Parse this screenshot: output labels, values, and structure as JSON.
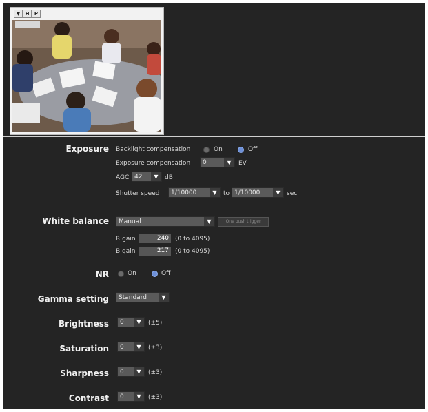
{
  "preview": {
    "buttons": [
      "▼",
      "H",
      "P"
    ],
    "overlay_icons": [
      "camera-control-icon",
      "zoom-icon",
      "focus-icon",
      "preset-icon"
    ]
  },
  "exposure": {
    "label": "Exposure",
    "backlight_label": "Backlight compensation",
    "on_label": "On",
    "off_label": "Off",
    "backlight_selected": "Off",
    "exp_comp_label": "Exposure compensation",
    "exp_comp_value": "0",
    "ev_unit": "EV",
    "agc_label": "AGC",
    "agc_value": "42",
    "db_unit": "dB",
    "shutter_label": "Shutter speed",
    "shutter_from": "1/10000",
    "to_label": "to",
    "shutter_to": "1/10000",
    "sec_unit": "sec."
  },
  "white_balance": {
    "label": "White balance",
    "mode": "Manual",
    "trigger_label": "One push trigger",
    "r_gain_label": "R gain",
    "r_gain": "240",
    "b_gain_label": "B gain",
    "b_gain": "217",
    "range": "(0 to 4095)"
  },
  "nr": {
    "label": "NR",
    "on_label": "On",
    "off_label": "Off",
    "selected": "Off"
  },
  "gamma": {
    "label": "Gamma setting",
    "value": "Standard"
  },
  "brightness": {
    "label": "Brightness",
    "value": "0",
    "range": "(±5)"
  },
  "saturation": {
    "label": "Saturation",
    "value": "0",
    "range": "(±3)"
  },
  "sharpness": {
    "label": "Sharpness",
    "value": "0",
    "range": "(±3)"
  },
  "contrast": {
    "label": "Contrast",
    "value": "0",
    "range": "(±3)"
  },
  "colors": {
    "panel_bg": "#242424",
    "radio_selected": "#6e90d8",
    "select_bg": "#5a5a5a"
  }
}
